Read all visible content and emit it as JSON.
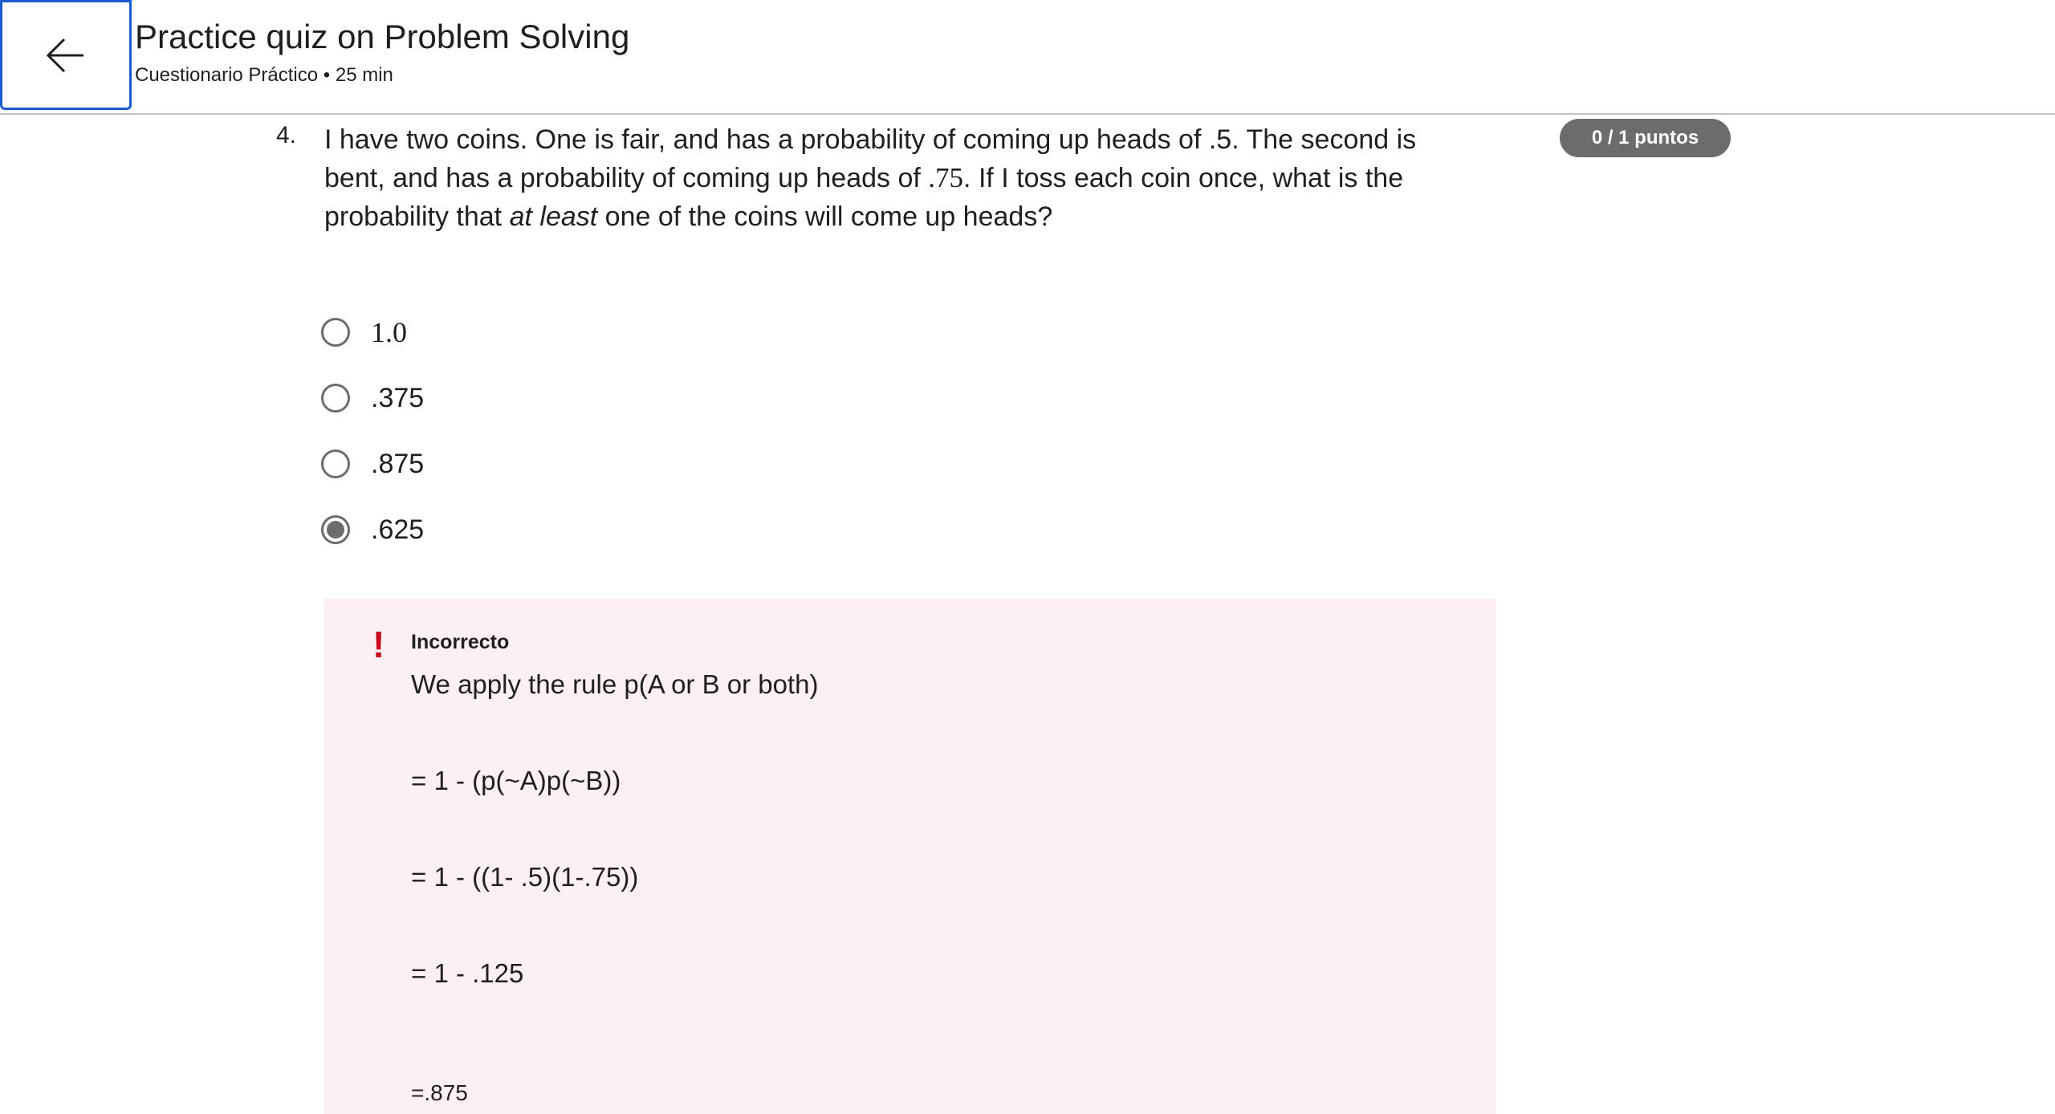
{
  "header": {
    "title": "Practice quiz on Problem Solving",
    "subtitle": "Cuestionario Práctico • 25 min"
  },
  "question": {
    "number": "4.",
    "text_part1": "I have two coins. One is fair, and has a probability of coming up heads of .5. The second is bent, and has a probability of coming up heads of ",
    "text_math": ".75",
    "text_part2": ". If I toss each coin once, what is the probability that ",
    "text_emphasis": "at least",
    "text_part3": " one of the coins will come up heads?",
    "score_badge": "0 / 1 puntos",
    "options": [
      {
        "label": "1.0",
        "selected": false
      },
      {
        "label": ".375",
        "selected": false
      },
      {
        "label": ".875",
        "selected": false
      },
      {
        "label": ".625",
        "selected": true
      }
    ]
  },
  "feedback": {
    "status": "Incorrecto",
    "icon": "!",
    "lines": [
      "We apply the rule p(A or B or both)",
      "= 1 - (p(~A)p(~B))",
      "= 1 - ((1- .5)(1-.75))",
      "= 1 - .125",
      "=.875"
    ]
  },
  "colors": {
    "accent": "#1a5bd0",
    "badge_bg": "#6c6c6c",
    "feedback_bg": "#fdf0f2",
    "error_red": "#c80a1e"
  }
}
